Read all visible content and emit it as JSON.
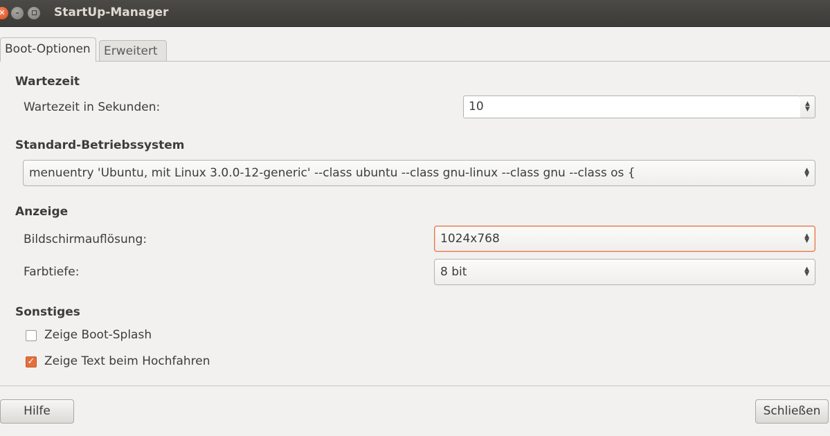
{
  "window": {
    "title": "StartUp-Manager"
  },
  "tabs": [
    {
      "label": "Boot-Optionen",
      "active": true
    },
    {
      "label": "Erweitert",
      "active": false
    }
  ],
  "wartezeit": {
    "heading": "Wartezeit",
    "label": "Wartezeit in Sekunden:",
    "value": "10"
  },
  "standard_os": {
    "heading": "Standard-Betriebssystem",
    "selected": "menuentry 'Ubuntu, mit Linux 3.0.0-12-generic' --class ubuntu --class gnu-linux --class gnu --class os {"
  },
  "anzeige": {
    "heading": "Anzeige",
    "resolution_label": "Bildschirmauflösung:",
    "resolution_value": "1024x768",
    "depth_label": "Farbtiefe:",
    "depth_value": "8 bit"
  },
  "sonstiges": {
    "heading": "Sonstiges",
    "splash_label": "Zeige Boot-Splash",
    "splash_checked": false,
    "text_label": "Zeige Text beim Hochfahren",
    "text_checked": true
  },
  "buttons": {
    "help": "Hilfe",
    "close": "Schließen"
  },
  "colors": {
    "accent": "#e36f3c",
    "titlebar": "#3c3b37"
  }
}
